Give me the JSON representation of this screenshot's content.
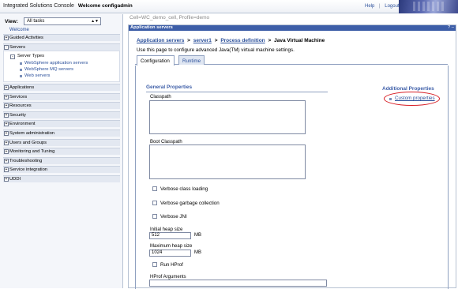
{
  "banner": {
    "brand": "Integrated Solutions Console",
    "welcome": "Welcome configadmin",
    "help": "Help",
    "separator": "|",
    "logout": "Logout"
  },
  "nav": {
    "view_label": "View:",
    "view_value": "All tasks",
    "welcome_link": "Welcome",
    "items": [
      {
        "label": "Guided Activities",
        "toggle": "+"
      },
      {
        "label": "Servers",
        "toggle": "-"
      },
      {
        "label": "Applications",
        "toggle": "+"
      },
      {
        "label": "Services",
        "toggle": "+"
      },
      {
        "label": "Resources",
        "toggle": "+"
      },
      {
        "label": "Security",
        "toggle": "+"
      },
      {
        "label": "Environment",
        "toggle": "+"
      },
      {
        "label": "System administration",
        "toggle": "+"
      },
      {
        "label": "Users and Groups",
        "toggle": "+"
      },
      {
        "label": "Monitoring and Tuning",
        "toggle": "+"
      },
      {
        "label": "Troubleshooting",
        "toggle": "+"
      },
      {
        "label": "Service integration",
        "toggle": "+"
      },
      {
        "label": "UDDI",
        "toggle": "+"
      }
    ],
    "server_types": {
      "label": "Server Types",
      "toggle": "-",
      "links": [
        "WebSphere application servers",
        "WebSphere MQ servers",
        "Web servers"
      ]
    }
  },
  "main": {
    "cell_path": "Cell=WC_demo_cell, Profile=demo",
    "panel_title": "Application servers",
    "panel_controls": "? –",
    "breadcrumb": {
      "app_servers": "Application servers",
      "server": "server1",
      "process_def": "Process definition",
      "current": "Java Virtual Machine",
      "sep": ">"
    },
    "description": "Use this page to configure advanced Java(TM) virtual machine settings.",
    "tabs": [
      "Configuration",
      "Runtime"
    ],
    "general_title": "General Properties",
    "classpath_label": "Classpath",
    "boot_classpath_label": "Boot Classpath",
    "verbose_class": "Verbose class loading",
    "verbose_gc": "Verbose garbage collection",
    "verbose_jni": "Verbose JNI",
    "initial_heap_label": "Initial heap size",
    "initial_heap_value": "512",
    "max_heap_label": "Maximum heap size",
    "max_heap_value": "1024",
    "mb": "MB",
    "run_hprof": "Run HProf",
    "hprof_args_label": "HProf Arguments",
    "additional_title": "Additional Properties",
    "custom_properties": "Custom properties"
  },
  "colors": {
    "header_blue": "#3d5ea8",
    "link_blue": "#2a4f9a",
    "highlight_red": "#d81f26"
  }
}
